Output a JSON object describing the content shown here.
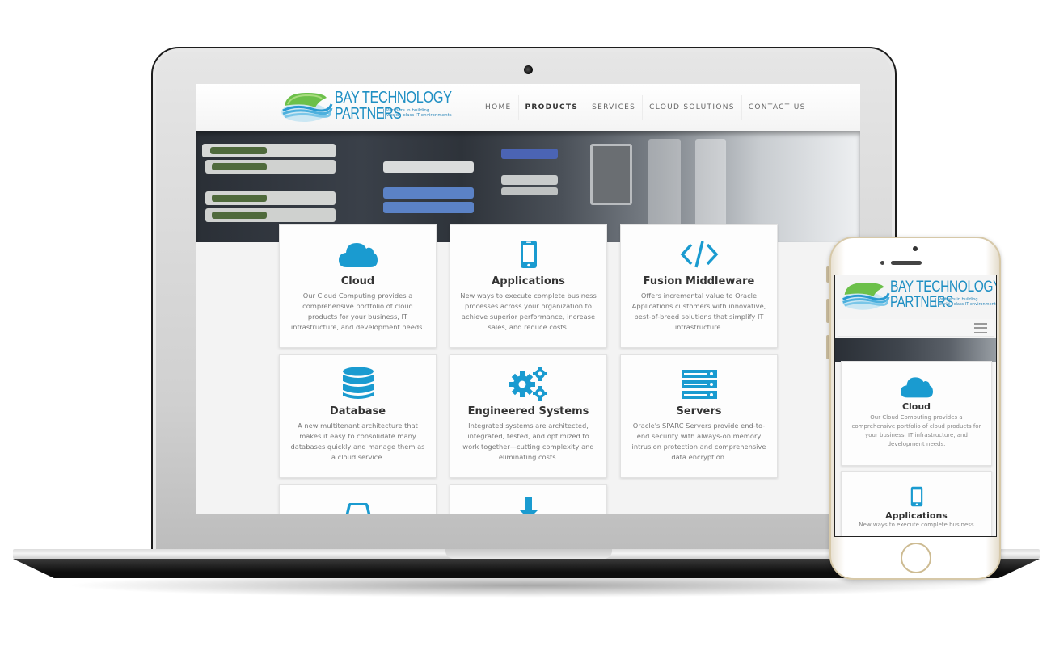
{
  "brand": {
    "name_line1": "BAY TECHNOLOGY",
    "name_line2": "PARTNERS",
    "tagline_line1": "Partners in building",
    "tagline_line2": "world - class IT environments",
    "accent_color": "#1a9bd0"
  },
  "nav": {
    "items": [
      {
        "label": "HOME",
        "active": false
      },
      {
        "label": "PRODUCTS",
        "active": true
      },
      {
        "label": "SERVICES",
        "active": false
      },
      {
        "label": "CLOUD SOLUTIONS",
        "active": false
      },
      {
        "label": "CONTACT US",
        "active": false
      }
    ]
  },
  "products": [
    {
      "icon": "cloud-icon",
      "title": "Cloud",
      "description": "Our Cloud Computing provides a comprehensive portfolio of cloud products for your business, IT infrastructure, and development needs."
    },
    {
      "icon": "mobile-phone-icon",
      "title": "Applications",
      "description": "New ways to execute complete business processes across your organization to achieve superior performance, increase sales, and reduce costs."
    },
    {
      "icon": "code-icon",
      "title": "Fusion Middleware",
      "description": "Offers incremental value to Oracle Applications customers with innovative, best-of-breed solutions that simplify IT infrastructure."
    },
    {
      "icon": "database-icon",
      "title": "Database",
      "description": "A new multitenant architecture that makes it easy to consolidate many databases quickly and manage them as a cloud service."
    },
    {
      "icon": "gears-icon",
      "title": "Engineered Systems",
      "description": "Integrated systems are architected, integrated, tested, and optimized to work together—cutting complexity and eliminating costs."
    },
    {
      "icon": "server-icon",
      "title": "Servers",
      "description": "Oracle's SPARC Servers provide end-to-end security with always-on memory intrusion protection and comprehensive data encryption."
    }
  ],
  "partial_cards": [
    {
      "icon": "storage-icon"
    },
    {
      "icon": "download-icon"
    }
  ],
  "mobile": {
    "cards": [
      {
        "icon": "cloud-icon",
        "title": "Cloud",
        "description": "Our Cloud Computing provides a comprehensive portfolio of cloud products for your business, IT infrastructure, and development needs."
      },
      {
        "icon": "mobile-phone-icon",
        "title": "Applications",
        "description": "New ways to execute complete business"
      }
    ]
  }
}
